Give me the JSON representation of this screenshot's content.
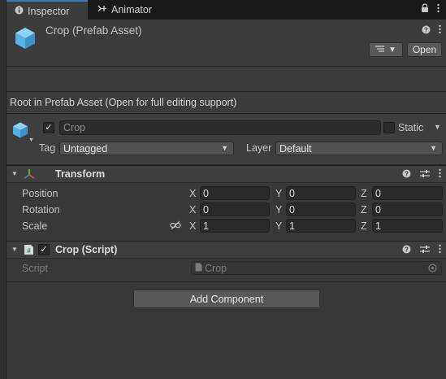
{
  "tabs": [
    {
      "label": "Inspector",
      "icon": "info-icon",
      "active": true
    },
    {
      "label": "Animator",
      "icon": "animator-icon",
      "active": false
    }
  ],
  "prefab": {
    "title": "Crop (Prefab Asset)",
    "open_label": "Open",
    "icon": "prefab-cube-icon"
  },
  "root_banner": "Root in Prefab Asset (Open for full editing support)",
  "game_object": {
    "name": "Crop",
    "active": true,
    "static_label": "Static",
    "static_checked": false,
    "tag_label": "Tag",
    "tag_value": "Untagged",
    "layer_label": "Layer",
    "layer_value": "Default"
  },
  "transform": {
    "title": "Transform",
    "rows": [
      {
        "label": "Position",
        "x": "0",
        "y": "0",
        "z": "0"
      },
      {
        "label": "Rotation",
        "x": "0",
        "y": "0",
        "z": "0"
      },
      {
        "label": "Scale",
        "x": "1",
        "y": "1",
        "z": "1"
      }
    ],
    "axes": {
      "x": "X",
      "y": "Y",
      "z": "Z"
    }
  },
  "script_component": {
    "title": "Crop (Script)",
    "enabled": true,
    "field_label": "Script",
    "field_value": "Crop"
  },
  "add_component_label": "Add Component",
  "colors": {
    "accent_tab": "#3a79bb",
    "prefab_blue": "#58b2e8",
    "panel_bg": "#383838"
  }
}
